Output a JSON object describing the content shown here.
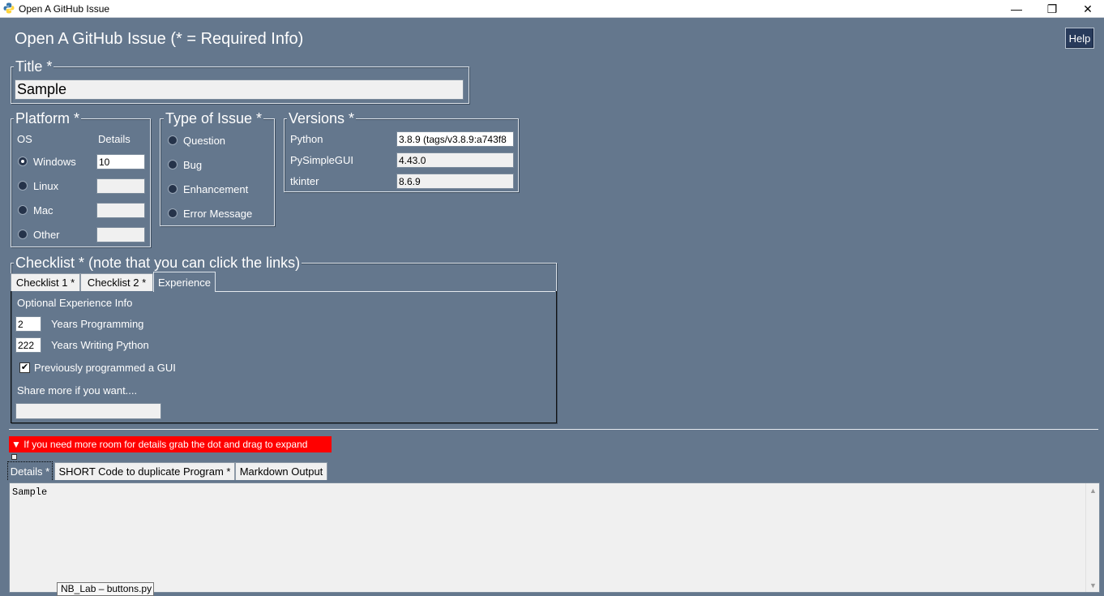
{
  "window": {
    "title": "Open A GitHub Issue",
    "minimize_glyph": "—",
    "restore_glyph": "❐",
    "close_glyph": "✕"
  },
  "header": {
    "title": "Open A GitHub Issue (* = Required Info)",
    "help_label": "Help"
  },
  "title_frame": {
    "label": "Title *",
    "value": "Sample"
  },
  "platform": {
    "label": "Platform *",
    "os_header": "OS",
    "details_header": "Details",
    "options": [
      {
        "label": "Windows",
        "details": "10",
        "selected": true
      },
      {
        "label": "Linux",
        "details": "",
        "selected": false
      },
      {
        "label": "Mac",
        "details": "",
        "selected": false
      },
      {
        "label": "Other",
        "details": "",
        "selected": false
      }
    ]
  },
  "issue_type": {
    "label": "Type of Issue *",
    "options": [
      {
        "label": "Question"
      },
      {
        "label": "Bug"
      },
      {
        "label": "Enhancement"
      },
      {
        "label": "Error Message"
      }
    ]
  },
  "versions": {
    "label": "Versions *",
    "rows": [
      {
        "label": "Python",
        "value": "3.8.9 (tags/v3.8.9:a743f8"
      },
      {
        "label": "PySimpleGUI",
        "value": "4.43.0"
      },
      {
        "label": "tkinter",
        "value": "8.6.9"
      }
    ]
  },
  "checklist": {
    "label": "Checklist * (note that you can click the links)",
    "tabs": [
      "Checklist 1 *",
      "Checklist 2  *",
      "Experience"
    ],
    "selected_tab": "Experience",
    "experience": {
      "heading": "Optional Experience Info",
      "years_programming_value": "2",
      "years_programming_label": "Years Programming",
      "years_python_value": "222",
      "years_python_label": "Years Writing Python",
      "gui_label": "Previously programmed a GUI",
      "gui_checked": true,
      "share_label": "Share more if you want....",
      "share_value": ""
    }
  },
  "expand_hint": "▼ If you need more room for details grab the dot and drag to expand",
  "details_tabs": [
    "Details *",
    "SHORT Code to duplicate Program *",
    "Markdown Output"
  ],
  "details_text": "Sample",
  "taskbar_tooltip": "NB_Lab – buttons.py",
  "colors": {
    "background": "#64778d",
    "button": "#283b5b",
    "warning": "#ff0000"
  }
}
